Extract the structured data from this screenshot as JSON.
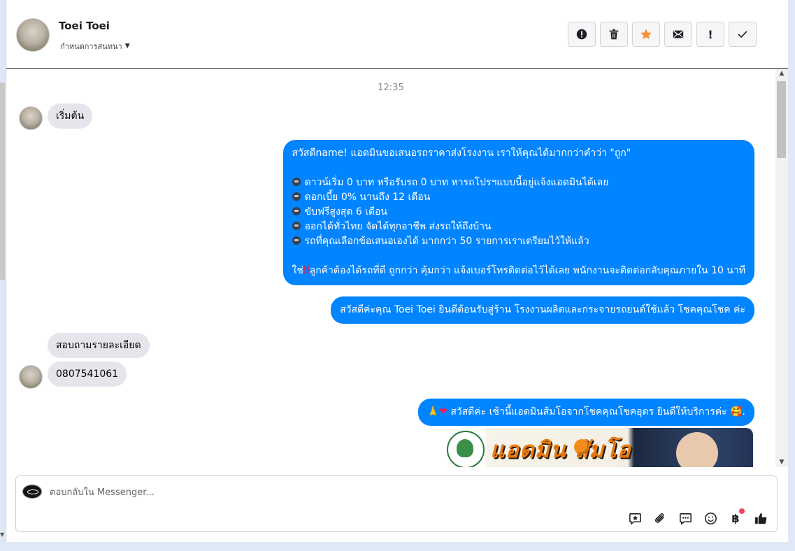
{
  "header": {
    "contact_name": "Toei Toei",
    "conversation_settings": "กำหนดการสนทนา",
    "toolbar": [
      {
        "icon": "alert-circle-icon",
        "label": "Mark as spam"
      },
      {
        "icon": "trash-icon",
        "label": "Delete"
      },
      {
        "icon": "star-icon",
        "label": "Star"
      },
      {
        "icon": "envelope-icon",
        "label": "Mark as unread"
      },
      {
        "icon": "exclamation-icon",
        "label": "Follow up"
      },
      {
        "icon": "check-icon",
        "label": "Mark as done"
      }
    ],
    "star_color": "#f7923a"
  },
  "thread": {
    "timestamp": "12:35",
    "msg_start": "เริ่มต้น",
    "offer": {
      "line1": "สวัสดีname! แอดมินขอเสนอรถราคาส่งโรงงาน เราให้คุณได้มากกว่าคำว่า \"ถูก\"",
      "bullets": [
        "ดาวน์เริ่ม 0 บาท หรือรับรถ 0 บาท หารถโปรฯแบบนี้อยู่แจ้งแอดมินได้เลย",
        "ดอกเบี้ย 0% นานถึง 12 เดือน",
        "ขับฟรีสูงสุด 6 เดือน",
        "ออกได้ทั่วไทย จัดได้ทุกอาชีพ ส่งรถให้ถึงบ้าน",
        "รถที่คุณเลือกข้อเสนอเองได้ มากกว่า 50 รายการเราเตรียมไว้ให้แล้ว"
      ],
      "closing_prefix": "ใช่",
      "closing_mark": "‼",
      "closing": "ลูกค้าต้องได้รถที่ดี ถูกกว่า คุ้มกว่า แจ้งเบอร์โทรติดต่อไว้ได้เลย พนักงานจะติดต่อกลับคุณภายใน 10 นาที"
    },
    "welcome": "สวัสดีค่ะคุณ Toei Toei ยินดีต้อนรับสู่ร้าน โรงงานผลิตและกระจายรถยนต์ใช้แล้ว โชคคุณโชค ค่ะ",
    "inquiry": "สอบถามรายละเอียด",
    "phone": "0807541061",
    "greeting_emoji": "🙏",
    "greeting_heart": "❤",
    "greeting": "สวัสดีค่ะ เช้านี้แอดมินส้มโอจากโชคคุณโชคอุดร ยินดีให้บริการค่ะ",
    "greeting_emoji_end": "🥰",
    "greeting_end": ".",
    "image_text": "แอดมิน สัมโอ"
  },
  "composer": {
    "placeholder": "ตอบกลับใน Messenger...",
    "tools": [
      "saved-reply-icon",
      "attachment-icon",
      "chat-icon",
      "emoji-icon",
      "baht-payment-icon",
      "like-icon"
    ],
    "baht_label": "฿"
  },
  "colors": {
    "outgoing_bubble": "#0084ff",
    "incoming_bubble": "#e4e6eb",
    "accent_dot": "#f3425f"
  }
}
